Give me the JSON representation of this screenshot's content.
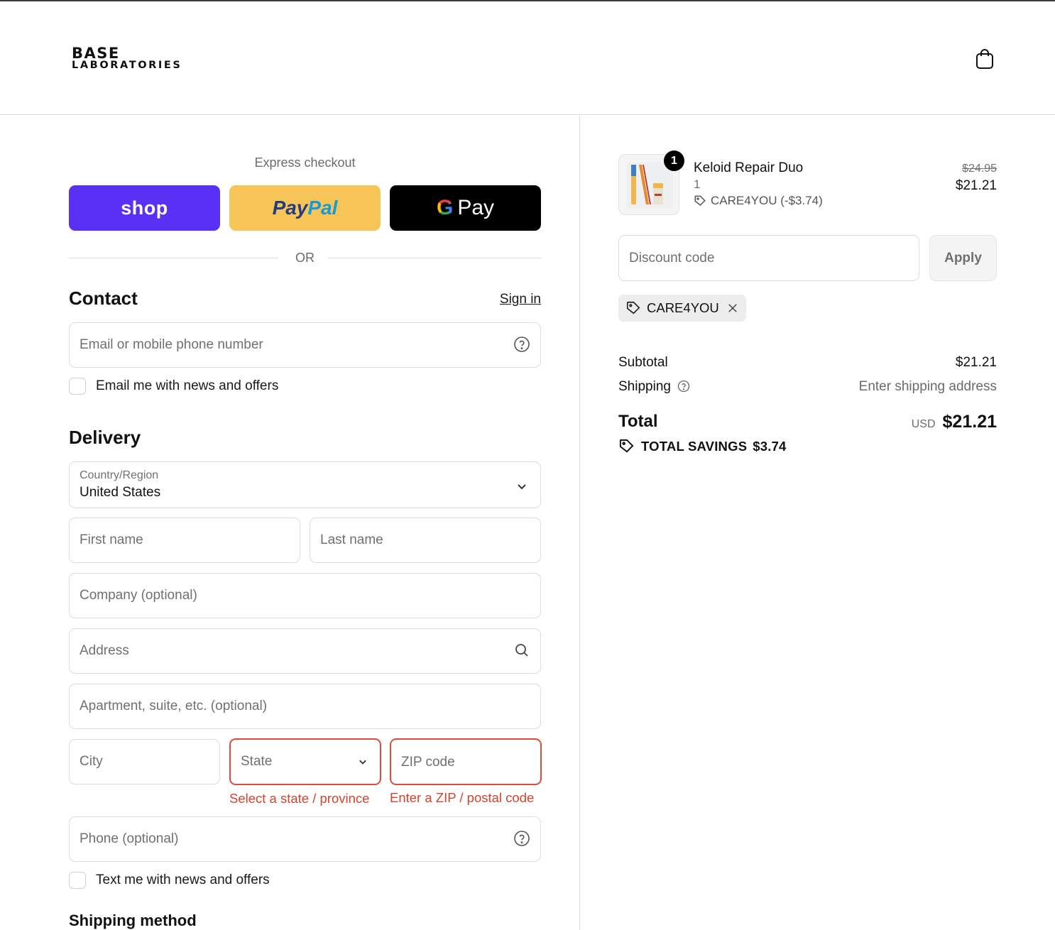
{
  "brand": {
    "line1": "BASE",
    "line2": "LABORATORIES"
  },
  "express": {
    "title": "Express checkout",
    "shop_label": "shop",
    "paypal_part1": "Pay",
    "paypal_part2": "Pal",
    "gpay_g": "G",
    "gpay_label": "Pay",
    "or_label": "OR"
  },
  "contact": {
    "title": "Contact",
    "sign_in": "Sign in",
    "email_placeholder": "Email or mobile phone number",
    "news_label": "Email me with news and offers"
  },
  "delivery": {
    "title": "Delivery",
    "country_label": "Country/Region",
    "country_value": "United States",
    "first_name": "First name",
    "last_name": "Last name",
    "company": "Company (optional)",
    "address": "Address",
    "apartment": "Apartment, suite, etc. (optional)",
    "city": "City",
    "state": "State",
    "state_error": "Select a state / province",
    "zip": "ZIP code",
    "zip_error": "Enter a ZIP / postal code",
    "phone": "Phone (optional)",
    "text_label": "Text me with news and offers"
  },
  "shipping_method": {
    "title": "Shipping method"
  },
  "order": {
    "item": {
      "name": "Keloid Repair Duo",
      "quantity": "1",
      "badge": "1",
      "discount": "CARE4YOU (-$3.74)",
      "price_original": "$24.95",
      "price": "$21.21"
    },
    "discount_placeholder": "Discount code",
    "apply_label": "Apply",
    "applied_code": "CARE4YOU",
    "subtotal_label": "Subtotal",
    "subtotal_value": "$21.21",
    "shipping_label": "Shipping",
    "shipping_value": "Enter shipping address",
    "total_label": "Total",
    "currency": "USD",
    "total_value": "$21.21",
    "savings_label": "TOTAL SAVINGS",
    "savings_value": "$3.74"
  },
  "colors": {
    "shop": "#5a31f4",
    "paypal": "#f7c557",
    "gpay": "#000000",
    "error": "#d1452f"
  },
  "icons": [
    "bag-icon",
    "help-circle-icon",
    "chevron-down-icon",
    "search-icon",
    "tag-icon",
    "close-icon"
  ]
}
